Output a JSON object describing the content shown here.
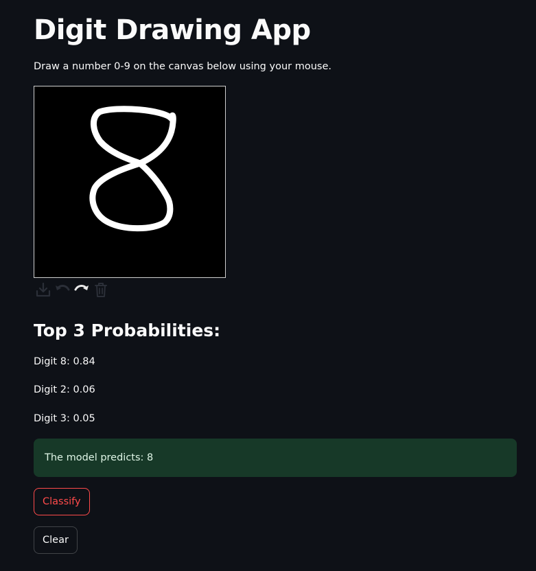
{
  "app": {
    "title": "Digit Drawing App",
    "instructions": "Draw a number 0-9 on the canvas below using your mouse."
  },
  "canvas": {
    "background": "#000000",
    "stroke_color": "#ffffff",
    "toolbar": [
      "download-icon",
      "undo-icon",
      "redo-icon",
      "trash-icon"
    ]
  },
  "results": {
    "heading": "Top 3 Probabilities:",
    "probabilities": [
      {
        "text": "Digit 8: 0.84",
        "digit": 8,
        "probability": 0.84
      },
      {
        "text": "Digit 2: 0.06",
        "digit": 2,
        "probability": 0.06
      },
      {
        "text": "Digit 3: 0.05",
        "digit": 3,
        "probability": 0.05
      }
    ],
    "prediction": "The model predicts: 8"
  },
  "buttons": {
    "classify": "Classify",
    "clear": "Clear"
  },
  "colors": {
    "background": "#0e1117",
    "text": "#fafafa",
    "success_bg": "#173928",
    "primary_red": "#ff4b4b"
  }
}
